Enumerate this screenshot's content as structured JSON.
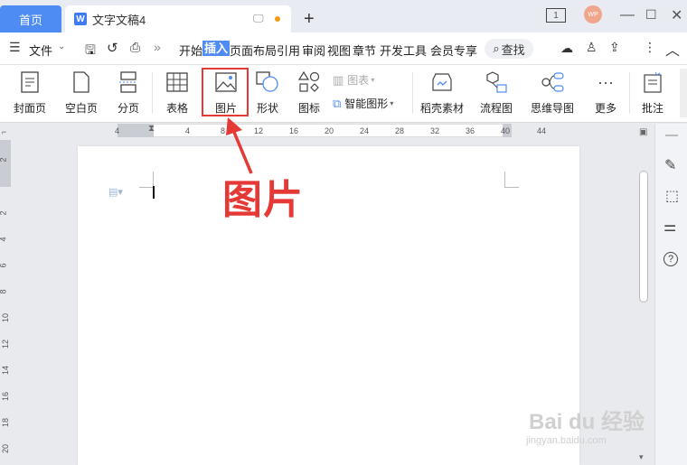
{
  "tabs": {
    "home": "首页",
    "doc": "文字文稿4"
  },
  "window": {
    "avatar": "WP"
  },
  "menubar": {
    "file": "文件",
    "tabs": [
      "开始",
      "插入",
      "页面布局",
      "引用",
      "审阅",
      "视图",
      "章节",
      "开发工具",
      "会员专享"
    ],
    "search": "查找"
  },
  "ribbon": {
    "items": [
      "封面页",
      "空白页",
      "分页",
      "表格",
      "图片",
      "形状",
      "图标",
      "稻壳素材",
      "流程图",
      "思维导图",
      "更多",
      "批注"
    ],
    "chart": "图表",
    "smartart": "智能图形"
  },
  "ruler": {
    "h": [
      "4",
      "4",
      "8",
      "12",
      "16",
      "20",
      "24",
      "28",
      "32",
      "36",
      "40",
      "44"
    ],
    "v": [
      "2",
      "2",
      "4",
      "6",
      "8",
      "10",
      "12",
      "14",
      "16",
      "18",
      "20"
    ]
  },
  "callout": "图片",
  "watermark": {
    "line1": "Bai du 经验",
    "line2": "jingyan.baidu.com"
  },
  "colors": {
    "accent": "#4e8cf3",
    "highlight": "#e53935"
  }
}
